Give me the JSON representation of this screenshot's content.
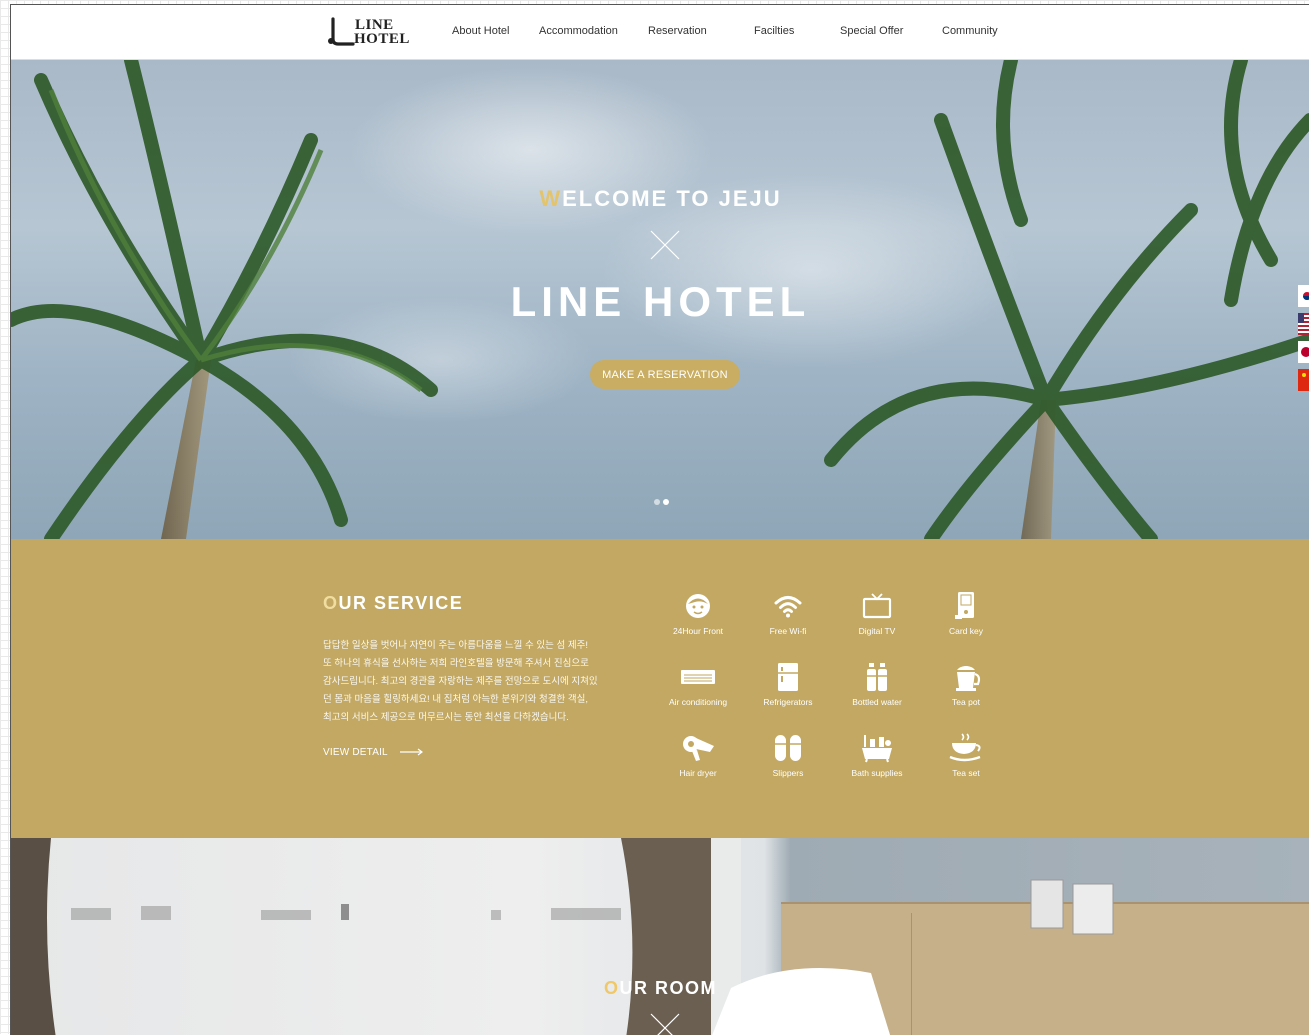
{
  "logo": {
    "line1": "LINE",
    "line2": "HOTEL"
  },
  "nav": [
    "About Hotel",
    "Accommodation",
    "Reservation",
    "Facilties",
    "Special Offer",
    "Community"
  ],
  "hero": {
    "welcome_first": "W",
    "welcome_rest": "ELCOME TO JEJU",
    "title": "LINE HOTEL",
    "cta": "MAKE A RESERVATION",
    "slides": 2,
    "active_slide": 1
  },
  "flags": [
    "Korea",
    "USA",
    "Japan",
    "China"
  ],
  "service": {
    "title_first": "O",
    "title_rest": "UR SERVICE",
    "paragraph": [
      "답답한 일상을 벗어나 자연이 주는 아름다움을 느낄 수 있는 섬 제주!",
      "또 하나의 휴식을 선사하는 저희 라인호텔을 방문해 주셔서 진심으로",
      "감사드립니다. 최고의 경관을 자랑하는 제주를 전망으로 도시에 지쳐있",
      "던 몸과 마음을 힐링하세요! 내 집처럼 아늑한 분위기와 청결한 객실,",
      "최고의 서비스 제공으로 머무르시는 동안 최선을 다하겠습니다."
    ],
    "view_detail": "VIEW DETAIL",
    "amenities": [
      {
        "label": "24Hour Front",
        "icon": "face-icon"
      },
      {
        "label": "Free Wi-fi",
        "icon": "wifi-icon"
      },
      {
        "label": "Digital TV",
        "icon": "tv-icon"
      },
      {
        "label": "Card key",
        "icon": "card-key-icon"
      },
      {
        "label": "Air conditioning",
        "icon": "air-conditioner-icon"
      },
      {
        "label": "Refrigerators",
        "icon": "refrigerator-icon"
      },
      {
        "label": "Bottled water",
        "icon": "bottled-water-icon"
      },
      {
        "label": "Tea pot",
        "icon": "tea-pot-icon"
      },
      {
        "label": "Hair dryer",
        "icon": "hair-dryer-icon"
      },
      {
        "label": "Slippers",
        "icon": "slippers-icon"
      },
      {
        "label": "Bath supplies",
        "icon": "bath-supplies-icon"
      },
      {
        "label": "Tea set",
        "icon": "tea-set-icon"
      }
    ]
  },
  "room": {
    "title_first": "O",
    "title_rest": "UR ROOM"
  },
  "colors": {
    "accent": "#c2a862",
    "button": "#c8ad62",
    "highlight": "#e4c46b"
  }
}
